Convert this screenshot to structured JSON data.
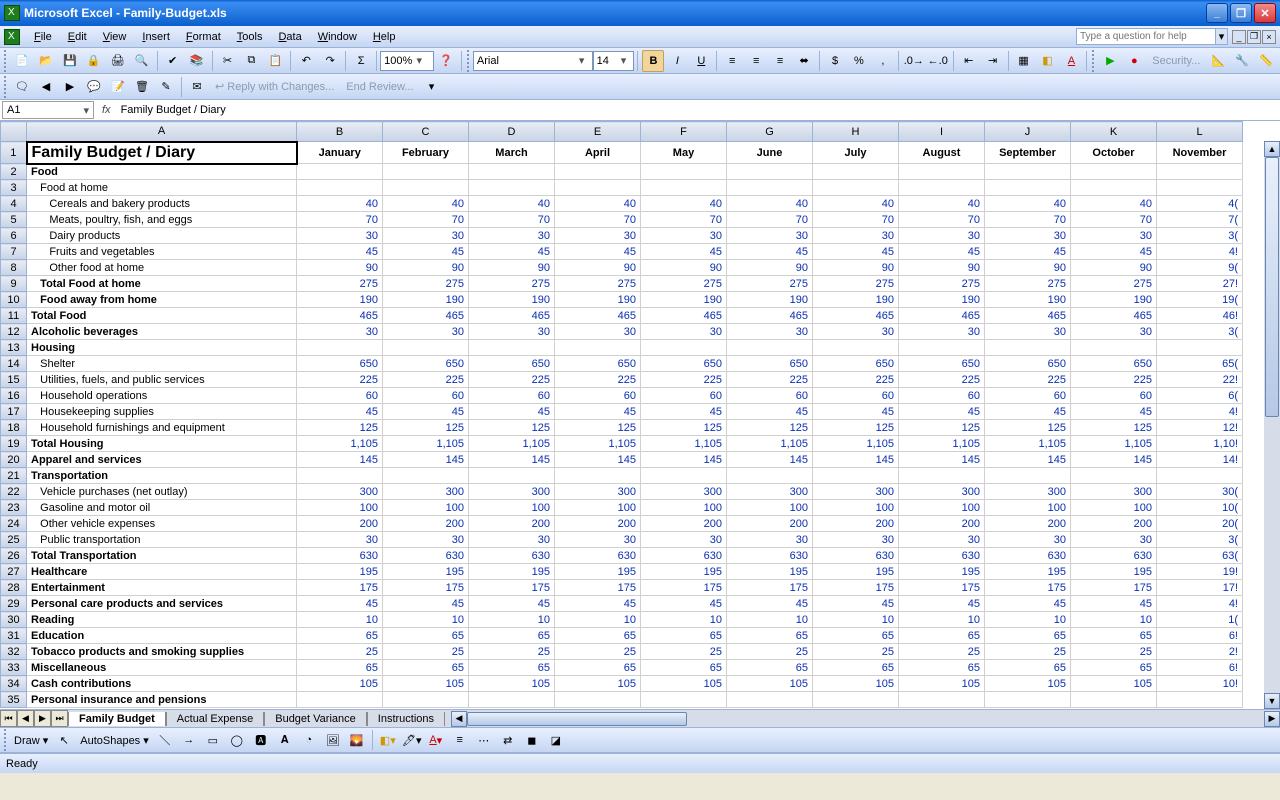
{
  "app": {
    "title": "Microsoft Excel - Family-Budget.xls"
  },
  "menu": {
    "items": [
      "File",
      "Edit",
      "View",
      "Insert",
      "Format",
      "Tools",
      "Data",
      "Window",
      "Help"
    ],
    "help_placeholder": "Type a question for help"
  },
  "toolbar": {
    "zoom": "100%",
    "font_name": "Arial",
    "font_size": "14",
    "security_label": "Security..."
  },
  "review_bar": {
    "reply": "Reply with Changes...",
    "end": "End Review..."
  },
  "formula_bar": {
    "name_box": "A1",
    "fx": "fx",
    "content": "Family Budget / Diary"
  },
  "columns": [
    "A",
    "B",
    "C",
    "D",
    "E",
    "F",
    "G",
    "H",
    "I",
    "J",
    "K",
    "L"
  ],
  "months": [
    "January",
    "February",
    "March",
    "April",
    "May",
    "June",
    "July",
    "August",
    "September",
    "October",
    "November"
  ],
  "rows": [
    {
      "n": 1,
      "kind": "title",
      "label": "Family Budget / Diary"
    },
    {
      "n": 2,
      "kind": "bold",
      "label": "Food"
    },
    {
      "n": 3,
      "kind": "sub",
      "label": "Food at home"
    },
    {
      "n": 4,
      "kind": "sub2",
      "label": "Cereals and bakery products",
      "val": 40,
      "edge": "4("
    },
    {
      "n": 5,
      "kind": "sub2",
      "label": "Meats, poultry, fish, and eggs",
      "val": 70,
      "edge": "7("
    },
    {
      "n": 6,
      "kind": "sub2",
      "label": "Dairy products",
      "val": 30,
      "edge": "3("
    },
    {
      "n": 7,
      "kind": "sub2",
      "label": "Fruits and vegetables",
      "val": 45,
      "edge": "4!"
    },
    {
      "n": 8,
      "kind": "sub2",
      "label": "Other food at home",
      "val": 90,
      "edge": "9("
    },
    {
      "n": 9,
      "kind": "boldsub",
      "label": "Total Food at home",
      "val": 275,
      "edge": "27!"
    },
    {
      "n": 10,
      "kind": "boldsub",
      "label": "Food away from home",
      "val": 190,
      "edge": "19("
    },
    {
      "n": 11,
      "kind": "bold",
      "label": "Total Food",
      "val": 465,
      "edge": "46!"
    },
    {
      "n": 12,
      "kind": "bold",
      "label": "Alcoholic beverages",
      "val": 30,
      "edge": "3("
    },
    {
      "n": 13,
      "kind": "bold",
      "label": "Housing"
    },
    {
      "n": 14,
      "kind": "sub",
      "label": "Shelter",
      "val": 650,
      "edge": "65("
    },
    {
      "n": 15,
      "kind": "sub",
      "label": "Utilities, fuels, and public services",
      "val": 225,
      "edge": "22!"
    },
    {
      "n": 16,
      "kind": "sub",
      "label": "Household operations",
      "val": 60,
      "edge": "6("
    },
    {
      "n": 17,
      "kind": "sub",
      "label": "Housekeeping supplies",
      "val": 45,
      "edge": "4!"
    },
    {
      "n": 18,
      "kind": "sub",
      "label": "Household furnishings and equipment",
      "val": 125,
      "edge": "12!"
    },
    {
      "n": 19,
      "kind": "bold",
      "label": "Total Housing",
      "val": "1,105",
      "edge": "1,10!"
    },
    {
      "n": 20,
      "kind": "bold",
      "label": "Apparel and services",
      "val": 145,
      "edge": "14!"
    },
    {
      "n": 21,
      "kind": "bold",
      "label": "Transportation"
    },
    {
      "n": 22,
      "kind": "sub",
      "label": "Vehicle purchases (net outlay)",
      "val": 300,
      "edge": "30("
    },
    {
      "n": 23,
      "kind": "sub",
      "label": "Gasoline and motor oil",
      "val": 100,
      "edge": "10("
    },
    {
      "n": 24,
      "kind": "sub",
      "label": "Other vehicle expenses",
      "val": 200,
      "edge": "20("
    },
    {
      "n": 25,
      "kind": "sub",
      "label": "Public transportation",
      "val": 30,
      "edge": "3("
    },
    {
      "n": 26,
      "kind": "bold",
      "label": "Total Transportation",
      "val": 630,
      "edge": "63("
    },
    {
      "n": 27,
      "kind": "bold",
      "label": "Healthcare",
      "val": 195,
      "edge": "19!"
    },
    {
      "n": 28,
      "kind": "bold",
      "label": "Entertainment",
      "val": 175,
      "edge": "17!"
    },
    {
      "n": 29,
      "kind": "bold",
      "label": "Personal care products and services",
      "val": 45,
      "edge": "4!"
    },
    {
      "n": 30,
      "kind": "bold",
      "label": "Reading",
      "val": 10,
      "edge": "1("
    },
    {
      "n": 31,
      "kind": "bold",
      "label": "Education",
      "val": 65,
      "edge": "6!"
    },
    {
      "n": 32,
      "kind": "bold",
      "label": "Tobacco products and smoking supplies",
      "val": 25,
      "edge": "2!"
    },
    {
      "n": 33,
      "kind": "bold",
      "label": "Miscellaneous",
      "val": 65,
      "edge": "6!"
    },
    {
      "n": 34,
      "kind": "bold",
      "label": "Cash contributions",
      "val": 105,
      "edge": "10!"
    },
    {
      "n": 35,
      "kind": "bold",
      "label": "Personal insurance and pensions"
    }
  ],
  "sheet_tabs": [
    "Family Budget",
    "Actual Expense",
    "Budget Variance",
    "Instructions"
  ],
  "active_tab": 0,
  "draw_bar": {
    "draw": "Draw",
    "autoshapes": "AutoShapes"
  },
  "status": {
    "text": "Ready"
  }
}
